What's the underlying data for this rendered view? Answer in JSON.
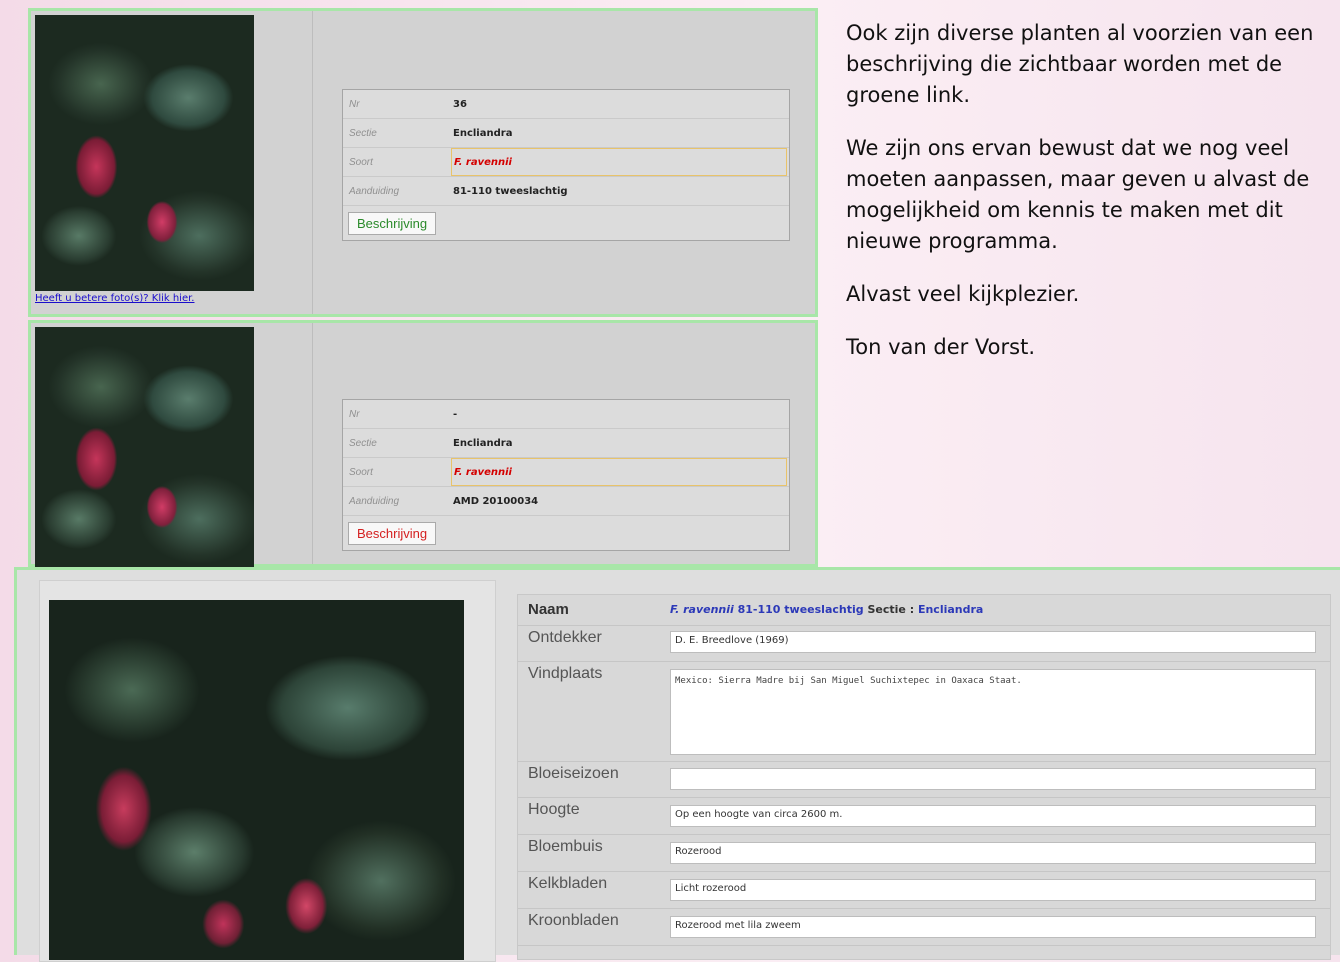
{
  "cards": [
    {
      "photo_link": "Heeft u betere foto(s)? Klik hier.",
      "rows": [
        {
          "label": "Nr",
          "value": "36"
        },
        {
          "label": "Sectie",
          "value": "Encliandra"
        },
        {
          "label": "Soort",
          "value": "F. ravennii"
        },
        {
          "label": "Aanduiding",
          "value": "81-110 tweeslachtig"
        }
      ],
      "button": "Beschrijving",
      "button_color": "#2a8a2a"
    },
    {
      "rows": [
        {
          "label": "Nr",
          "value": "-"
        },
        {
          "label": "Sectie",
          "value": "Encliandra"
        },
        {
          "label": "Soort",
          "value": "F. ravennii"
        },
        {
          "label": "Aanduiding",
          "value": "AMD 20100034"
        }
      ],
      "button": "Beschrijving",
      "button_color": "#d42020"
    }
  ],
  "side_text": {
    "p1": "Ook zijn diverse planten al voorzien van een beschrijving die zichtbaar worden met de groene link.",
    "p2": "We zijn ons ervan bewust dat we nog veel moeten aanpassen, maar geven u alvast de mogelijkheid om kennis te maken met dit nieuwe programma.",
    "p3": "Alvast veel kijkplezier.",
    "p4": "Ton van der Vorst."
  },
  "details": {
    "naam_label": "Naam",
    "naam_species": "F. ravennii",
    "naam_code": "81-110 tweeslachtig",
    "naam_sectie_label": "Sectie :",
    "naam_sectie": "Encliandra",
    "fields": [
      {
        "label": "Ontdekker",
        "value": "D. E. Breedlove (1969)"
      },
      {
        "label": "Vindplaats",
        "value": "Mexico: Sierra Madre bij San Miguel Suchixtepec in Oaxaca Staat."
      },
      {
        "label": "Bloeiseizoen",
        "value": ""
      },
      {
        "label": "Hoogte",
        "value": "Op een hoogte van circa 2600 m."
      },
      {
        "label": "Bloembuis",
        "value": "Rozerood"
      },
      {
        "label": "Kelkbladen",
        "value": "Licht rozerood"
      },
      {
        "label": "Kroonbladen",
        "value": "Rozerood met lila zweem"
      }
    ]
  },
  "colors": {
    "card_border": "#a8e6a8",
    "soort_red": "#d40000",
    "link_blue": "#1a0dcc",
    "naam_blue": "#2c39b8"
  }
}
